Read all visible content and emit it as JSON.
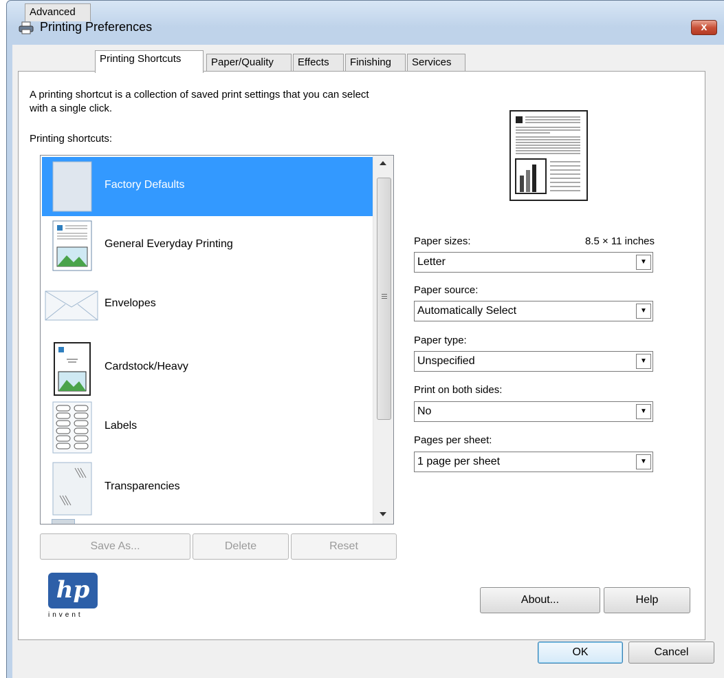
{
  "window": {
    "title": "Printing Preferences",
    "close_label": "x"
  },
  "tabs": [
    {
      "label": "Advanced"
    },
    {
      "label": "Printing Shortcuts",
      "active": true
    },
    {
      "label": "Paper/Quality"
    },
    {
      "label": "Effects"
    },
    {
      "label": "Finishing"
    },
    {
      "label": "Services"
    }
  ],
  "intro_text": {
    "line1": "A printing shortcut is a collection of saved print settings that you can select",
    "line2": "with a single click."
  },
  "shortcuts_label": "Printing shortcuts:",
  "shortcuts": [
    {
      "label": "Factory Defaults",
      "selected": true,
      "icon": "blank-page-icon"
    },
    {
      "label": "General Everyday Printing",
      "icon": "document-with-picture-icon"
    },
    {
      "label": "Envelopes",
      "icon": "envelope-icon"
    },
    {
      "label": "Cardstock/Heavy",
      "icon": "cardstock-icon"
    },
    {
      "label": "Labels",
      "icon": "labels-sheet-icon"
    },
    {
      "label": "Transparencies",
      "icon": "transparency-icon"
    }
  ],
  "list_buttons": {
    "save_as": "Save As...",
    "delete": "Delete",
    "reset": "Reset"
  },
  "settings": {
    "paper_sizes_label": "Paper sizes:",
    "paper_sizes_dimension": "8.5 × 11 inches",
    "paper_sizes_value": "Letter",
    "paper_source_label": "Paper source:",
    "paper_source_value": "Automatically Select",
    "paper_type_label": "Paper type:",
    "paper_type_value": "Unspecified",
    "duplex_label": "Print on both sides:",
    "duplex_value": "No",
    "pages_per_sheet_label": "Pages per sheet:",
    "pages_per_sheet_value": "1 page per sheet"
  },
  "logo": {
    "text": "hp",
    "tagline": "invent"
  },
  "panel_buttons": {
    "about": "About...",
    "help": "Help"
  },
  "dialog_buttons": {
    "ok": "OK",
    "cancel": "Cancel"
  },
  "colors": {
    "selection": "#3399ff",
    "frame": "#bfd3ea",
    "hp_blue": "#2d5fa8"
  }
}
